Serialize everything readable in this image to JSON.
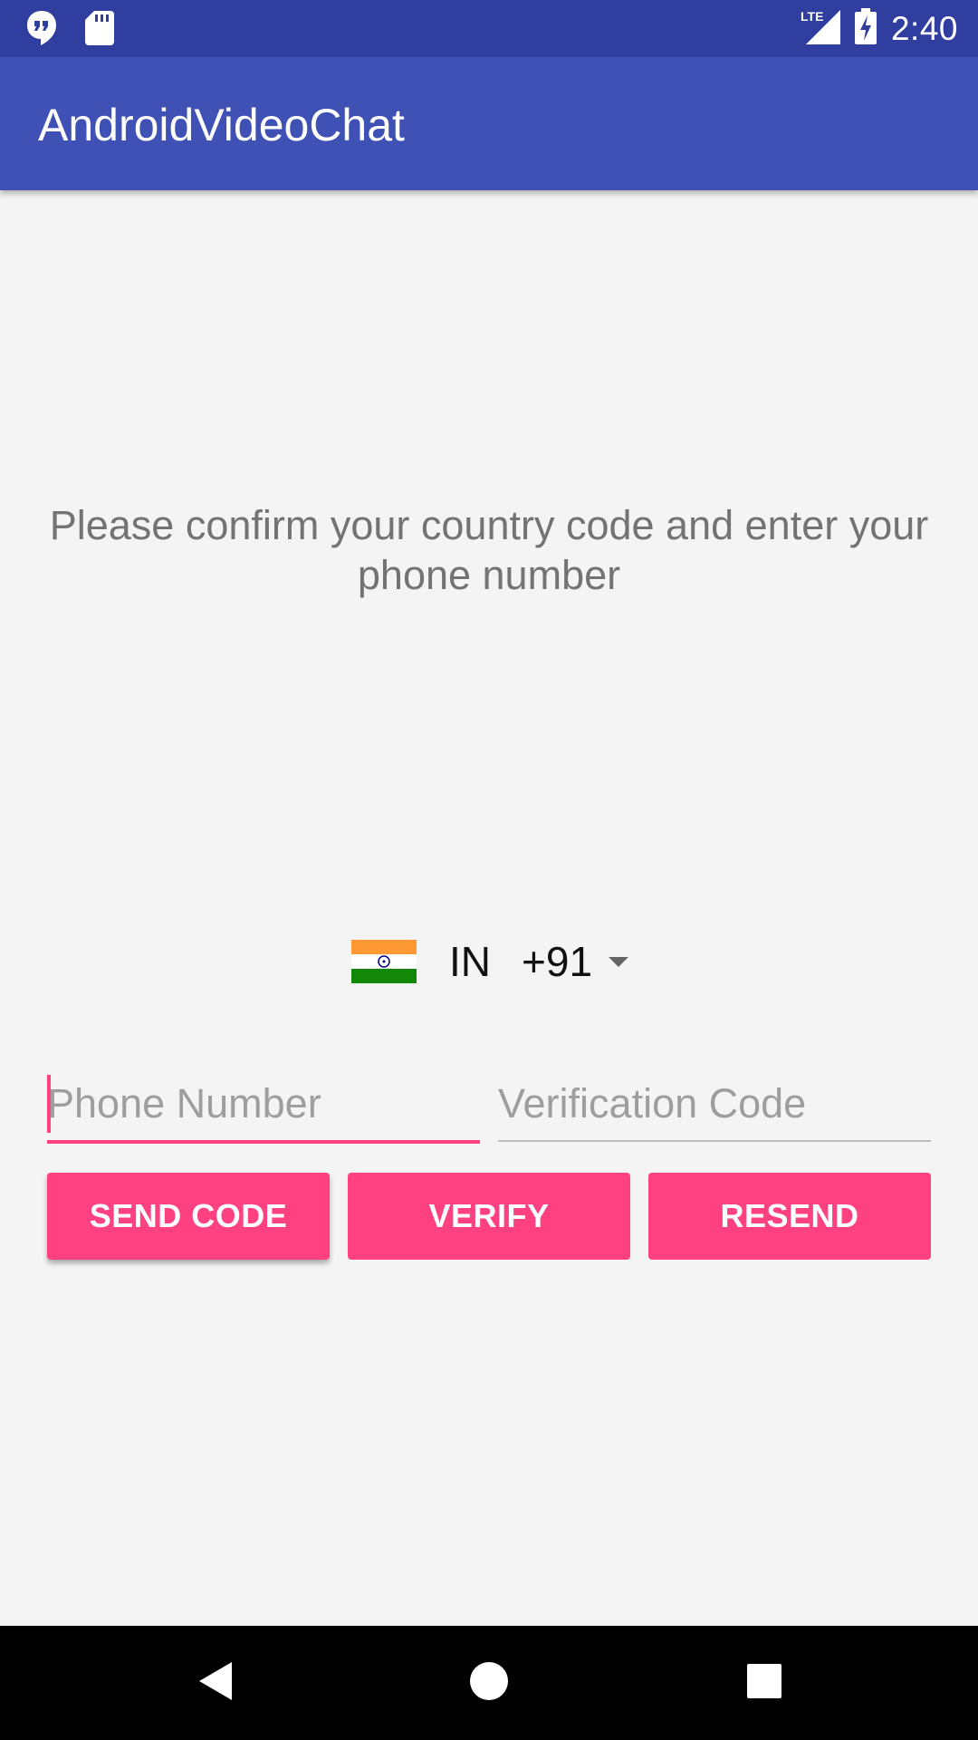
{
  "status_bar": {
    "time": "2:40",
    "icons": [
      "hangouts-icon",
      "sd-card-icon",
      "lte-signal-icon",
      "battery-charging-icon"
    ],
    "lte_label": "LTE"
  },
  "app_bar": {
    "title": "AndroidVideoChat"
  },
  "main": {
    "prompt": "Please confirm your country code and enter your phone number",
    "country_picker": {
      "flag": "india-flag-icon",
      "country_code": "IN",
      "dial_code": "+91"
    },
    "phone_field": {
      "placeholder": "Phone Number",
      "value": ""
    },
    "verification_field": {
      "placeholder": "Verification Code",
      "value": ""
    },
    "buttons": {
      "send_code": "SEND CODE",
      "verify": "VERIFY",
      "resend": "RESEND"
    }
  },
  "nav_bar": {
    "icons": [
      "back-icon",
      "home-icon",
      "recents-icon"
    ]
  },
  "colors": {
    "status_bar": "#303f9f",
    "app_bar": "#3f51b5",
    "accent": "#ff4081",
    "background": "#f4f4f4"
  }
}
